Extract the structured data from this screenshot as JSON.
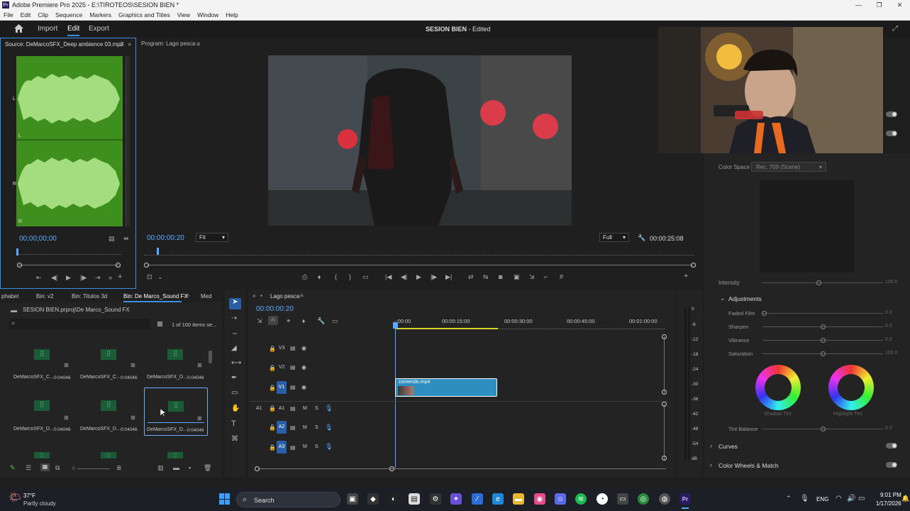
{
  "app": {
    "window_title": "Adobe Premiere Pro 2025 - E:\\TIROTEOS\\SESION BIEN *",
    "logo_text": "Pr",
    "menu": [
      "File",
      "Edit",
      "Clip",
      "Sequence",
      "Markers",
      "Graphics and Titles",
      "View",
      "Window",
      "Help"
    ],
    "win_minimize": "—",
    "win_maximize": "❐",
    "win_close": "✕"
  },
  "workspace": {
    "tabs": [
      "Import",
      "Edit",
      "Export"
    ],
    "active_tab": "Edit",
    "sequence_name": "SESION BIEN",
    "sequence_state": " - Edited"
  },
  "source_monitor": {
    "title": "Source: DeMarcoSFX_Deep ambience 03.mp3",
    "menu_glyph": "≡",
    "timecode": "00;00;00;00",
    "channel_top": "L",
    "channel_bottom": "R",
    "channel_top_b": "L",
    "channel_bottom_b": "R",
    "waveform_color": "#9fd97a",
    "bg_color": "#3e8f1e"
  },
  "program_monitor": {
    "title": "Program: Lago pesca",
    "menu_glyph": "≡",
    "timecode": "00:00:00:20",
    "fit_label": "Fit",
    "full_label": "Full",
    "duration": "00:00:25:08"
  },
  "project_panel": {
    "tabs": [
      "phabet",
      "Bin: v2",
      "Bin: Titulos 3d",
      "Bin: De Marco_Sound FX",
      "Med"
    ],
    "active_tab": "Bin: De Marco_Sound FX",
    "path": "SESION BIEN.prproj\\De Marco_Sound FX",
    "search_placeholder": "",
    "items_count": "1 of 100 items se...",
    "items": [
      {
        "name": "DeMarcoSFX_C...",
        "duration": "0:04046"
      },
      {
        "name": "DeMarcoSFX_C...",
        "duration": "0:04046"
      },
      {
        "name": "DeMarcoSFX_D...",
        "duration": "0:04046"
      },
      {
        "name": "DeMarcoSFX_D...",
        "duration": "0:04046"
      },
      {
        "name": "DeMarcoSFX_D...",
        "duration": "0:04046"
      },
      {
        "name": "DeMarcoSFX_D...",
        "duration": "0:04046"
      }
    ]
  },
  "timeline": {
    "sequence_tab": "Lago pesca",
    "timecode": "00:00:00:20",
    "ruler": [
      "-:00:00",
      "00:00:15:00",
      "00:00:30:00",
      "00:00:45:00",
      "00:01:00:00"
    ],
    "video_tracks": [
      "V3",
      "V2",
      "V1"
    ],
    "audio_tracks": [
      "A1",
      "A2",
      "A3"
    ],
    "audio_source": "A1",
    "track_m": "M",
    "track_s": "S",
    "clip_name": "comendo.mp4",
    "clip_color": "#2f8ec0"
  },
  "audio_meter": {
    "labels": [
      "0",
      "-6",
      "-12",
      "-18",
      "-24",
      "-30",
      "-36",
      "-42",
      "-48",
      "-54",
      "dB"
    ]
  },
  "lumetri": {
    "color_space_label": "Color Space",
    "color_space_value": "Rec. 709 (Scene)",
    "intensity_label": "Intensity",
    "intensity_value": "100.0",
    "adjustments_label": "Adjustments",
    "sliders": [
      {
        "label": "Faded Film",
        "value": "0.0"
      },
      {
        "label": "Sharpen",
        "value": "0.0"
      },
      {
        "label": "Vibrance",
        "value": "0.0"
      },
      {
        "label": "Saturation",
        "value": "100.0"
      }
    ],
    "shadow_tint": "Shadow Tint",
    "highlight_tint": "Highlight Tint",
    "tint_balance_label": "Tint Balance",
    "tint_balance_value": "0.0",
    "curves_label": "Curves",
    "color_wheels_label": "Color Wheels & Match"
  },
  "taskbar": {
    "temperature": "37°F",
    "weather": "Partly cloudy",
    "search_label": "Search",
    "lang": "ENG",
    "time": "9:01 PM",
    "date": "1/17/2026"
  }
}
